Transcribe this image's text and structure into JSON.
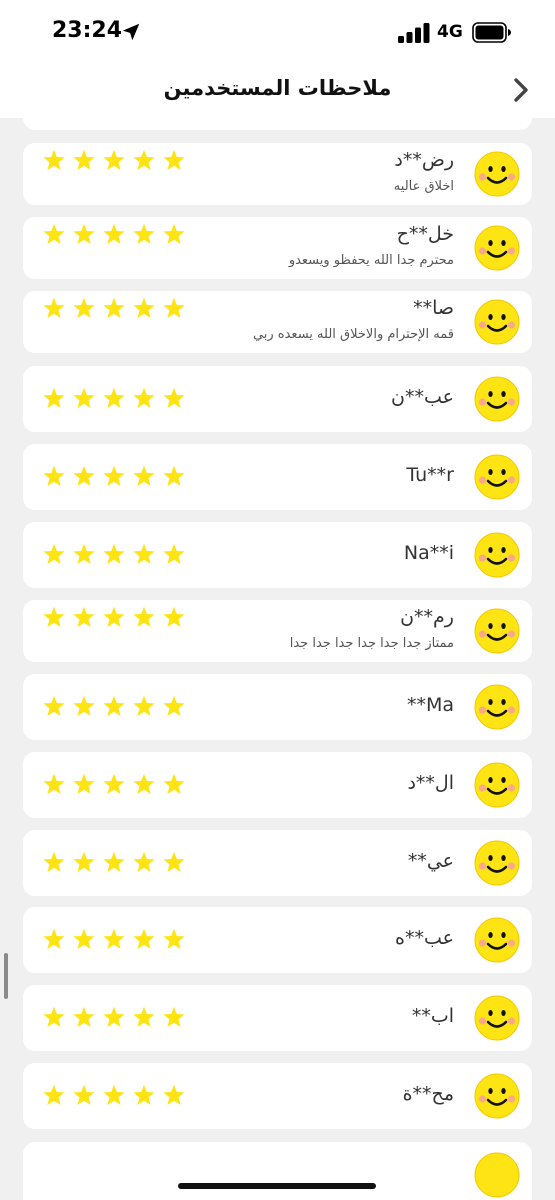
{
  "status_bar": {
    "time": "23:24",
    "network": "4G"
  },
  "header": {
    "title": "ملاحظات المستخدمين"
  },
  "colors": {
    "star": "#FFE414",
    "face": "#FFE414",
    "face_outline": "#F5C800",
    "cheek": "#F9A98A"
  },
  "icons": {
    "back": "chevron-right-icon",
    "face": "smiley-face-icon",
    "star": "star-icon"
  },
  "reviews": [
    {
      "name": "رض**د",
      "comment": "اخلاق عاليه",
      "rating": 5
    },
    {
      "name": "خل**ح",
      "comment": "محترم جدا الله يحفظو ويسعدو",
      "rating": 5
    },
    {
      "name": "صا**",
      "comment": "قمه الإحترام والاخلاق الله  يسعده ربي",
      "rating": 5
    },
    {
      "name": "عب**ن",
      "comment": "",
      "rating": 5
    },
    {
      "name": "Tu**r",
      "comment": "",
      "rating": 5
    },
    {
      "name": "Na**i",
      "comment": "",
      "rating": 5
    },
    {
      "name": "رم**ن",
      "comment": "ممتاز جدا جدا جدا جدا جدا جدا",
      "rating": 5
    },
    {
      "name": "Ma**",
      "comment": "",
      "rating": 5
    },
    {
      "name": "ال**د",
      "comment": "",
      "rating": 5
    },
    {
      "name": "عي**",
      "comment": "",
      "rating": 5
    },
    {
      "name": "عب**ه",
      "comment": "",
      "rating": 5
    },
    {
      "name": "اب**",
      "comment": "",
      "rating": 5
    },
    {
      "name": "مح**ة",
      "comment": "",
      "rating": 5
    }
  ]
}
